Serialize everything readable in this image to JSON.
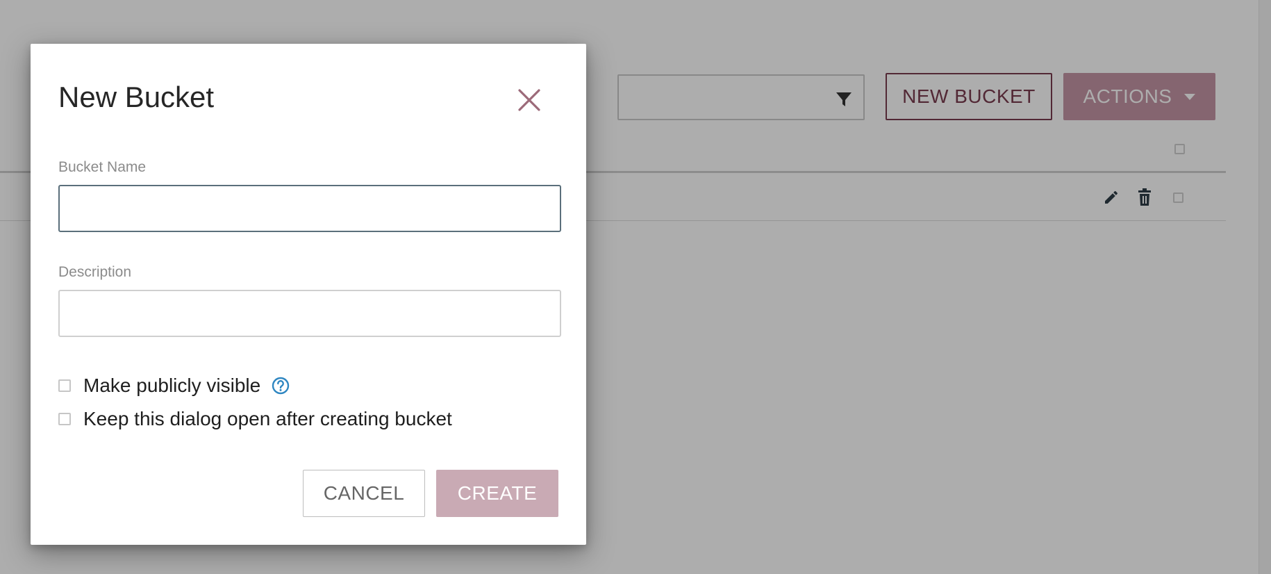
{
  "background": {
    "toolbar": {
      "filter_placeholder": "",
      "new_bucket_label": "NEW BUCKET",
      "actions_label": "ACTIONS"
    }
  },
  "dialog": {
    "title": "New Bucket",
    "fields": {
      "bucket_name": {
        "label": "Bucket Name",
        "value": ""
      },
      "description": {
        "label": "Description",
        "value": ""
      }
    },
    "checkboxes": {
      "public": {
        "label": "Make publicly visible",
        "checked": false
      },
      "keep_open": {
        "label": "Keep this dialog open after creating bucket",
        "checked": false
      }
    },
    "buttons": {
      "cancel_label": "CANCEL",
      "create_label": "CREATE"
    }
  },
  "colors": {
    "primary": "#7a3b4f",
    "primary_disabled": "#c9aab4",
    "help_icon": "#2e86c1",
    "close_icon": "#9c6a79"
  },
  "icons": [
    "filter-icon",
    "close-icon",
    "help-icon",
    "pencil-icon",
    "trash-icon",
    "caret-down-icon"
  ]
}
